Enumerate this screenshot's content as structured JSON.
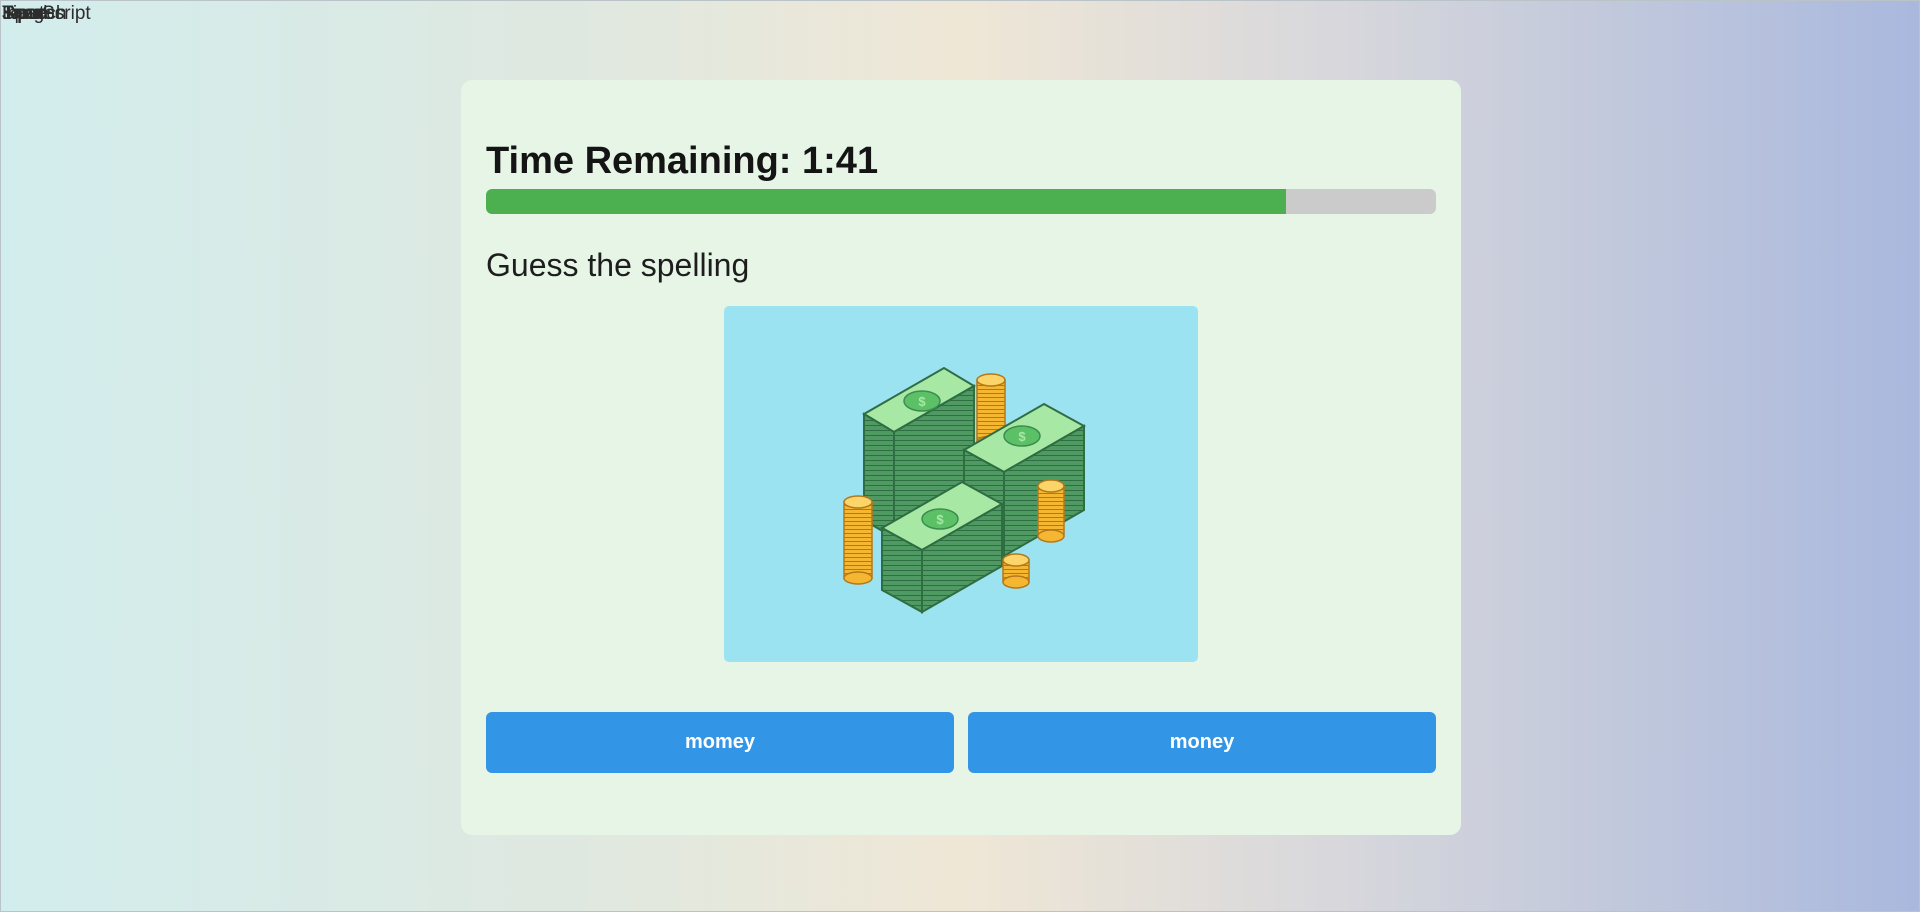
{
  "overlapping_labels": [
    "JavaScript",
    "Input",
    "Read",
    "Speech",
    "Images",
    "Tips"
  ],
  "timer": {
    "label": "Time Remaining: 1:41",
    "progress_fraction": 0.842
  },
  "question": {
    "prompt": "Guess the spelling",
    "image_icon": "money-stack-illustration"
  },
  "choices": [
    {
      "label": "momey"
    },
    {
      "label": "money"
    }
  ],
  "colors": {
    "progress_fill": "#4caf50",
    "progress_track": "#cbcbcb",
    "button": "#3395e6",
    "card": "#e7f5e7",
    "image_bg": "#9ce3f2"
  }
}
